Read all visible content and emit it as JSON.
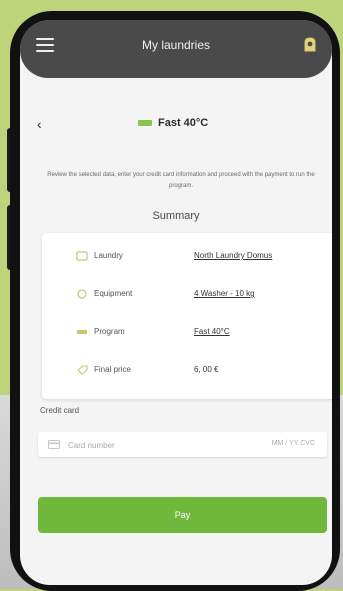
{
  "colors": {
    "accent_green": "#6fb83c",
    "app_bar": "#4a4a4a",
    "background_green": "#bfd47a"
  },
  "appbar": {
    "title": "My laundries",
    "menu_icon": "hamburger-icon",
    "right_icon": "profile-icon"
  },
  "header": {
    "back_icon": "back-arrow-icon",
    "program_icon": "washing-program-icon",
    "program_title": "Fast 40°C"
  },
  "description": "Review the selected data, enter your credit card information and proceed with the payment to run the program.",
  "summary": {
    "title": "Summary",
    "rows": [
      {
        "icon": "laundry-icon",
        "label": "Laundry",
        "value": "North Laundry Domus"
      },
      {
        "icon": "machine-icon",
        "label": "Equipment",
        "value": "4 Washer - 10 kg"
      },
      {
        "icon": "program-icon",
        "label": "Program",
        "value": "Fast 40°C"
      },
      {
        "icon": "price-tag-icon",
        "label": "Final price",
        "value": "6, 00 €"
      }
    ]
  },
  "credit_card": {
    "label": "Credit card",
    "icon": "credit-card-icon",
    "placeholder": "Card number",
    "meta": "MM / YY  CVC"
  },
  "pay_button": {
    "label": "Pay"
  }
}
